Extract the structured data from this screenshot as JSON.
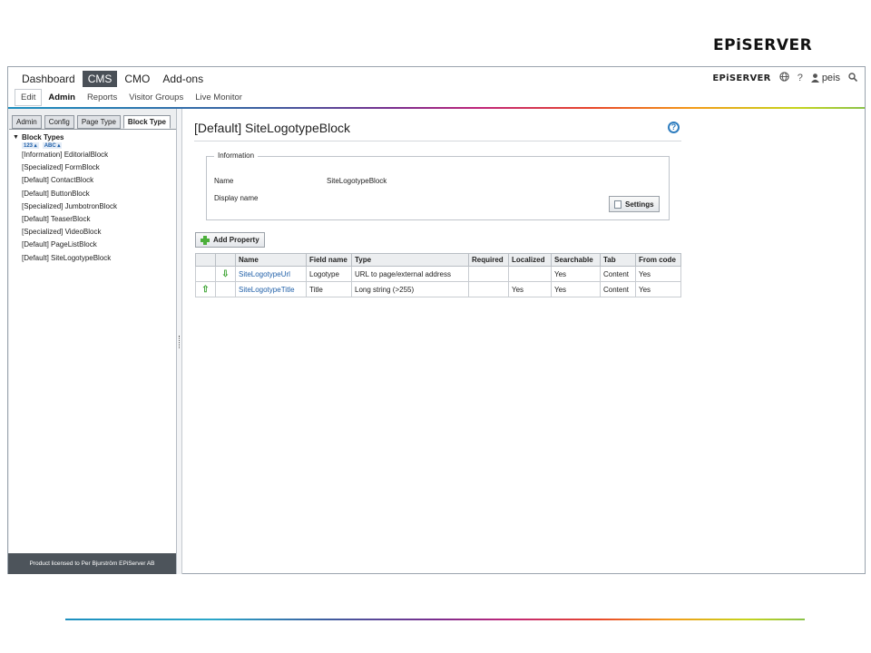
{
  "slide": {
    "logo": "EPiSERVER"
  },
  "nav": {
    "main": [
      "Dashboard",
      "CMS",
      "CMO",
      "Add-ons"
    ],
    "active_main": "CMS",
    "sub": [
      "Edit",
      "Admin",
      "Reports",
      "Visitor Groups",
      "Live Monitor"
    ],
    "active_sub": "Admin",
    "brand": "EPiSERVER",
    "help": "?",
    "user": "peis"
  },
  "left": {
    "tabs": [
      "Admin",
      "Config",
      "Page Type",
      "Block Type"
    ],
    "active_tab": "Block Type",
    "tree_root": "Block Types",
    "sort_buttons": [
      "123",
      "ABC"
    ],
    "items": [
      "[Information] EditorialBlock",
      "[Specialized] FormBlock",
      "[Default] ContactBlock",
      "[Default] ButtonBlock",
      "[Specialized] JumbotronBlock",
      "[Default] TeaserBlock",
      "[Specialized] VideoBlock",
      "[Default] PageListBlock",
      "[Default] SiteLogotypeBlock"
    ],
    "footer": "Product licensed to Per Bjurström EPiServer AB"
  },
  "main": {
    "title": "[Default] SiteLogotypeBlock",
    "info": {
      "legend": "Information",
      "name_label": "Name",
      "name_value": "SiteLogotypeBlock",
      "display_label": "Display name",
      "display_value": "",
      "settings_button": "Settings"
    },
    "add_property": "Add Property",
    "table": {
      "headers": [
        "Name",
        "Field name",
        "Type",
        "Required",
        "Localized",
        "Searchable",
        "Tab",
        "From code"
      ],
      "rows": [
        {
          "up": "",
          "down": "⇩",
          "name": "SiteLogotypeUrl",
          "field": "Logotype",
          "type": "URL to page/external address",
          "required": "",
          "localized": "",
          "searchable": "Yes",
          "tab": "Content",
          "from_code": "Yes"
        },
        {
          "up": "⇧",
          "down": "",
          "name": "SiteLogotypeTitle",
          "field": "Title",
          "type": "Long string (>255)",
          "required": "",
          "localized": "Yes",
          "searchable": "Yes",
          "tab": "Content",
          "from_code": "Yes"
        }
      ]
    }
  }
}
